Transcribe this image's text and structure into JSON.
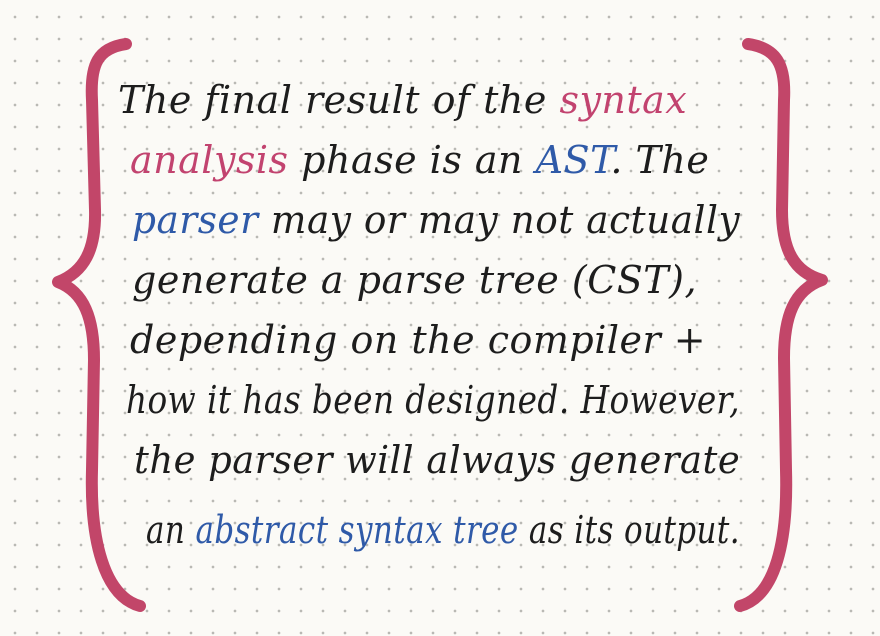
{
  "colors": {
    "ink": "#1d1d1d",
    "pink": "#c2436f",
    "blue": "#2f5aa8",
    "brace": "#c24669",
    "paper": "#fbfaf6",
    "dots": "#b9b9b4"
  },
  "lines": [
    {
      "segments": [
        {
          "text": "The final result of the ",
          "color": "ink"
        },
        {
          "text": "syntax",
          "color": "pink"
        }
      ]
    },
    {
      "segments": [
        {
          "text": "analysis",
          "color": "pink"
        },
        {
          "text": " phase is an ",
          "color": "ink"
        },
        {
          "text": "AST",
          "color": "blue"
        },
        {
          "text": ". The",
          "color": "ink"
        }
      ]
    },
    {
      "segments": [
        {
          "text": "parser",
          "color": "blue"
        },
        {
          "text": " may or may not actually",
          "color": "ink"
        }
      ]
    },
    {
      "segments": [
        {
          "text": "generate a parse tree (CST),",
          "color": "ink"
        }
      ]
    },
    {
      "segments": [
        {
          "text": "depending on the compiler +",
          "color": "ink"
        }
      ]
    },
    {
      "segments": [
        {
          "text": "how it has been designed. However,",
          "color": "ink"
        }
      ]
    },
    {
      "segments": [
        {
          "text": "the parser will always generate",
          "color": "ink"
        }
      ]
    },
    {
      "segments": [
        {
          "text": "an ",
          "color": "ink"
        },
        {
          "text": "abstract syntax tree",
          "color": "blue"
        },
        {
          "text": " as its output.",
          "color": "ink"
        }
      ]
    }
  ]
}
